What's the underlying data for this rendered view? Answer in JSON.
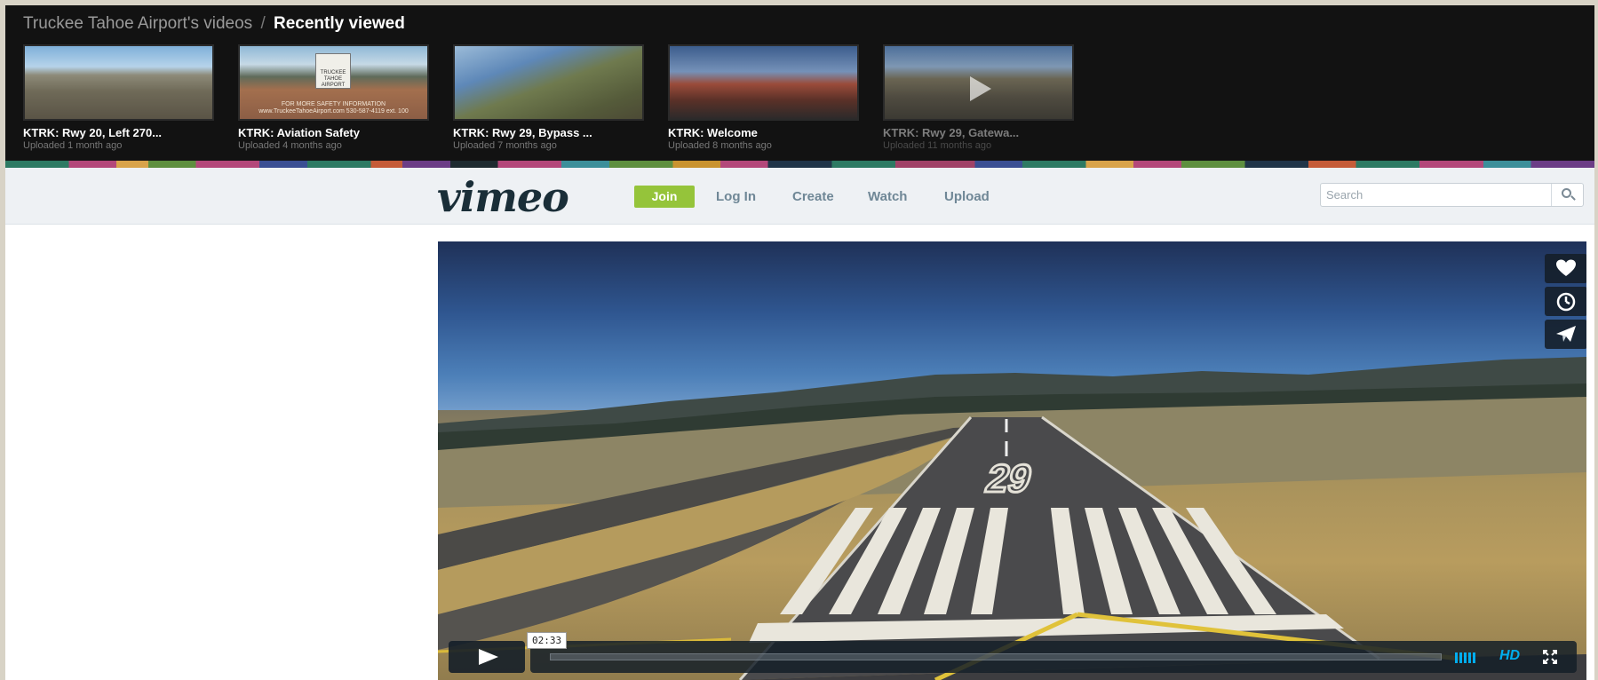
{
  "strip": {
    "title": "Truckee Tahoe Airport's videos",
    "separator": "/",
    "current": "Recently viewed",
    "videos": [
      {
        "title": "KTRK: Rwy 20, Left 270...",
        "uploaded": "Uploaded 1 month ago"
      },
      {
        "title": "KTRK: Aviation Safety",
        "uploaded": "Uploaded 4 months ago",
        "thumb_text": "FOR MORE SAFETY INFORMATION www.TruckeeTahoeAirport.com 530-587-4119 ext. 100",
        "logo_text": "TRUCKEE TAHOE AIRPORT"
      },
      {
        "title": "KTRK: Rwy 29, Bypass ...",
        "uploaded": "Uploaded 7 months ago"
      },
      {
        "title": "KTRK: Welcome",
        "uploaded": "Uploaded 8 months ago"
      },
      {
        "title": "KTRK: Rwy 29, Gatewa...",
        "uploaded": "Uploaded 11 months ago"
      }
    ]
  },
  "nav": {
    "logo": "vimeo",
    "join": "Join",
    "login": "Log In",
    "create": "Create",
    "watch": "Watch",
    "upload": "Upload",
    "search_placeholder": "Search"
  },
  "player": {
    "time": "02:33",
    "hd_label": "HD",
    "runway_number": "29",
    "icons": [
      "heart-icon",
      "clock-icon",
      "send-icon",
      "play-icon",
      "volume-icon",
      "fullscreen-icon"
    ]
  },
  "colors": {
    "join_green": "#95c43a",
    "accent_blue": "#00adef",
    "strip_bg": "#121212",
    "nav_bg": "#eef1f4"
  }
}
